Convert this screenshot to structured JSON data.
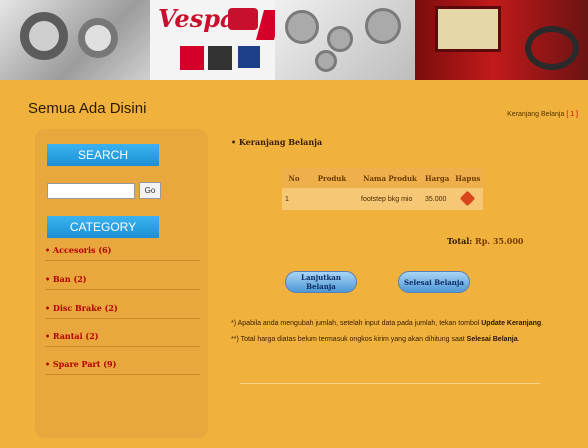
{
  "header": {
    "site_title": "Semua Ada Disini",
    "cart_link": "Keranjang Belanja",
    "cart_count": "[ 1 ]"
  },
  "sidebar": {
    "search_heading": "SEARCH",
    "search_input": {
      "value": "",
      "placeholder": ""
    },
    "go_button": "Go",
    "category_heading": "CATEGORY",
    "categories": [
      {
        "label": "• Accesoris (6)"
      },
      {
        "label": "• Ban (2)"
      },
      {
        "label": "• Disc Brake (2)"
      },
      {
        "label": "• Rantai (2)"
      },
      {
        "label": "• Spare Part (9)"
      }
    ]
  },
  "cart": {
    "section_title": "• Keranjang Belanja",
    "columns": [
      "No",
      "Produk",
      "Nama Produk",
      "Harga",
      "Hapus"
    ],
    "rows": [
      {
        "no": "1",
        "produk": "",
        "nama_produk": "footstep bkg mio",
        "harga": "35.000"
      }
    ],
    "total_label": "Total:",
    "total_value": "Rp. 35.000",
    "continue_button": "Lanjutkan Belanja",
    "finish_button": "Selesai Belanja",
    "notes": [
      {
        "text": "*) Apabila anda mengubah jumlah, setelah input data pada jumlah, tekan tombol ",
        "bold": "Update Keranjang",
        "end": "."
      },
      {
        "text": "**) Total harga diatas belum termasuk ongkos kirim yang akan dihitung saat ",
        "bold": "Selesai Belanja",
        "end": "."
      }
    ]
  },
  "banner": {
    "vespa_text": "Vespa"
  },
  "colors": {
    "background": "#f0b23c",
    "sidebar": "#e9a83d",
    "heading_blue": "#2aa3e6",
    "category_red": "#b30000"
  }
}
